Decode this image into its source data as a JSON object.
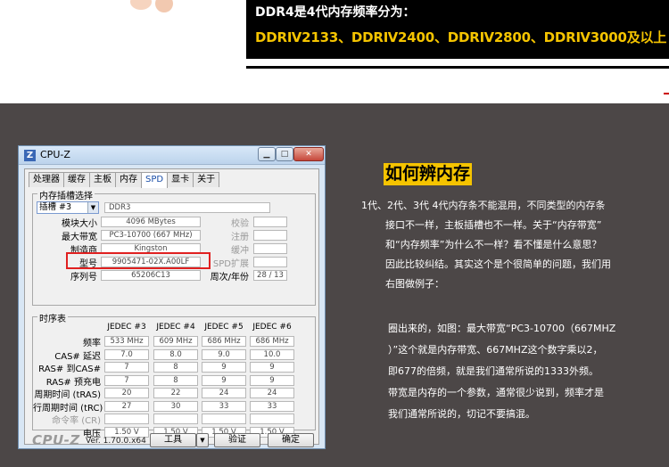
{
  "banner": {
    "spec_title": "DDR4是4代内存频率分为：",
    "spec_list": "DDRⅣ2133、DDRⅣ2400、DDRⅣ2800、DDRⅣ3000及以上"
  },
  "cpuz": {
    "app_icon": "Z",
    "window_title": "CPU-Z",
    "tabs": [
      "处理器",
      "缓存",
      "主板",
      "内存",
      "SPD",
      "显卡",
      "关于"
    ],
    "active_tab": "SPD",
    "slot_group_title": "内存插槽选择",
    "slot_selected": "插槽 #3",
    "slot_type": "DDR3",
    "labels": {
      "module_size": "模块大小",
      "max_bandwidth": "最大带宽",
      "manufacturer": "制造商",
      "model": "型号",
      "serial": "序列号",
      "correction": "校验",
      "registered": "注册",
      "buffered": "缓冲",
      "spd_ext": "SPD扩展",
      "week_year": "周次/年份"
    },
    "values": {
      "module_size": "4096 MBytes",
      "max_bandwidth": "PC3-10700 (667 MHz)",
      "manufacturer": "Kingston",
      "model": "9905471-02X.A00LF",
      "serial": "65206C13",
      "week_year": "28 / 13"
    },
    "timing_group_title": "时序表",
    "timing_columns": [
      "JEDEC #3",
      "JEDEC #4",
      "JEDEC #5",
      "JEDEC #6"
    ],
    "timing_rows": [
      {
        "label": "频率",
        "values": [
          "533 MHz",
          "609 MHz",
          "686 MHz",
          "686 MHz"
        ]
      },
      {
        "label": "CAS# 延迟",
        "values": [
          "7.0",
          "8.0",
          "9.0",
          "10.0"
        ]
      },
      {
        "label": "RAS# 到CAS#",
        "values": [
          "7",
          "8",
          "9",
          "9"
        ]
      },
      {
        "label": "RAS# 预充电",
        "values": [
          "7",
          "8",
          "9",
          "9"
        ]
      },
      {
        "label": "周期时间 (tRAS)",
        "values": [
          "20",
          "22",
          "24",
          "24"
        ]
      },
      {
        "label": "行周期时间 (tRC)",
        "values": [
          "27",
          "30",
          "33",
          "33"
        ]
      },
      {
        "label": "命令率 (CR)",
        "values": [
          "",
          "",
          "",
          ""
        ]
      },
      {
        "label": "电压",
        "values": [
          "1.50 V",
          "1.50 V",
          "1.50 V",
          "1.50 V"
        ]
      }
    ],
    "brand": "CPU-Z",
    "version": "Ver. 1.70.0.x64",
    "btn_tools": "工具",
    "btn_validate": "验证",
    "btn_ok": "确定"
  },
  "explain": {
    "heading": "如何辨内存",
    "para1": [
      "1代、2代、3代  4代内存条不能混用，不同类型的内存条",
      "接口不一样，主板插槽也不一样。关于“内存带宽”",
      "和“内存频率”为什么不一样？看不懂是什么意思？",
      "因此比较纠结。其实这个是个很简单的问题，我们用",
      "右图做例子："
    ],
    "para2": [
      "圈出来的，如图：最大带宽“PC3-10700（667MHZ",
      "）”这个就是内存带宽、667MHZ这个数字乘以2，",
      "即677的倍频，就是我们通常所说的1333外频。",
      "带宽是内存的一个参数，通常很少说到，频率才是",
      "我们通常所说的，切记不要搞混。"
    ]
  }
}
